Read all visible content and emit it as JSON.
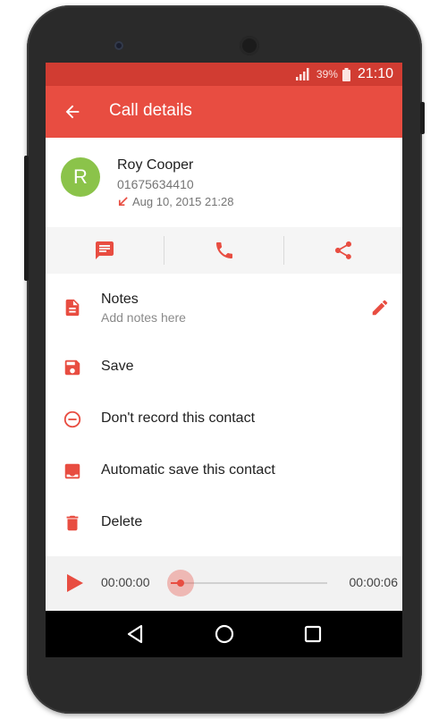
{
  "status_bar": {
    "battery_percent": "39%",
    "time": "21:10"
  },
  "app_bar": {
    "title": "Call details",
    "back_icon": "arrow-left-icon"
  },
  "contact": {
    "avatar_letter": "R",
    "name": "Roy Cooper",
    "phone": "01675634410",
    "call_date": "Aug 10, 2015 21:28",
    "call_direction_icon": "incoming-call-arrow-icon"
  },
  "actions": [
    {
      "name": "message",
      "icon": "message-icon"
    },
    {
      "name": "call",
      "icon": "phone-icon"
    },
    {
      "name": "share",
      "icon": "share-icon"
    }
  ],
  "notes": {
    "label": "Notes",
    "placeholder": "Add notes here",
    "edit_icon": "pencil-icon"
  },
  "menu": {
    "save": "Save",
    "dont_record": "Don't record this contact",
    "auto_save": "Automatic save this contact",
    "delete": "Delete"
  },
  "player": {
    "current_time": "00:00:00",
    "total_time": "00:00:06",
    "progress": 0.06
  },
  "colors": {
    "accent": "#e84d41",
    "status_bar": "#d13c32",
    "avatar": "#8bc34a"
  }
}
